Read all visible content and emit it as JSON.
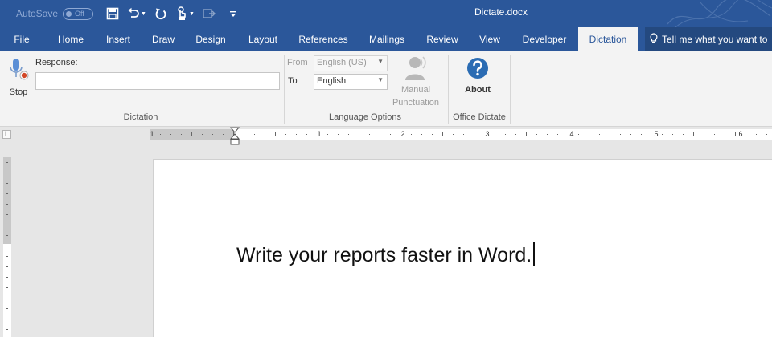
{
  "qat": {
    "autosave_label": "AutoSave",
    "autosave_state": "Off",
    "icons": [
      "save-icon",
      "undo-icon",
      "redo-icon",
      "touch-mode-icon",
      "customize-icon"
    ]
  },
  "document_title": "Dictate.docx",
  "tabs": [
    "File",
    "Home",
    "Insert",
    "Draw",
    "Design",
    "Layout",
    "References",
    "Mailings",
    "Review",
    "View",
    "Developer",
    "Dictation"
  ],
  "active_tab": "Dictation",
  "tell_me": "Tell me what you want to",
  "ribbon": {
    "dictation": {
      "stop_label": "Stop",
      "response_label": "Response:",
      "response_value": "",
      "group_label": "Dictation"
    },
    "language_options": {
      "from_label": "From",
      "from_value": "English (US)",
      "to_label": "To",
      "to_value": "English",
      "manual_line1": "Manual",
      "manual_line2": "Punctuation",
      "group_label": "Language Options"
    },
    "office_dictate": {
      "about_label": "About",
      "group_label": "Office Dictate"
    }
  },
  "ruler": {
    "corner_label": "L",
    "numbers": [
      "1",
      "1",
      "2",
      "3",
      "4",
      "5",
      "6"
    ]
  },
  "document": {
    "text": "Write your reports faster in Word."
  },
  "colors": {
    "brand": "#2b579a",
    "about_icon": "#2b6cb3",
    "mic": "#5b8fd6",
    "record_dot": "#d24726"
  }
}
